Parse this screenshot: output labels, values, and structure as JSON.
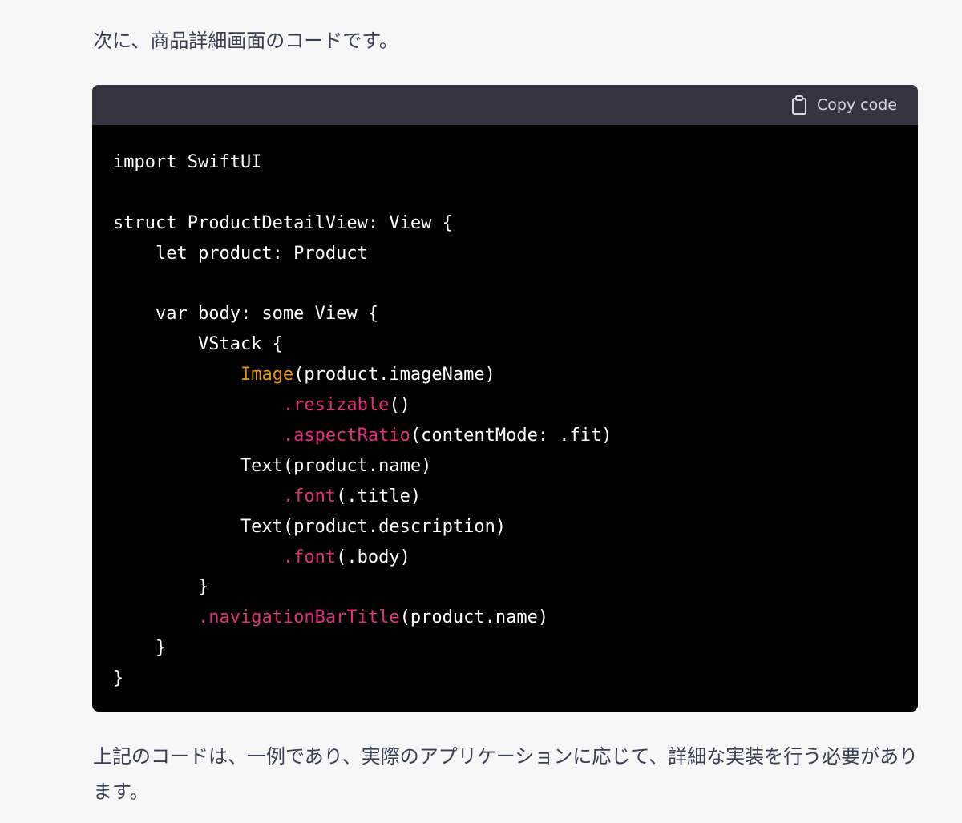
{
  "message": {
    "intro": "次に、商品詳細画面のコードです。",
    "outro": "上記のコードは、一例であり、実際のアプリケーションに応じて、詳細な実装を行う必要があります。"
  },
  "code_block": {
    "copy_label": "Copy code",
    "copy_icon": "clipboard-icon",
    "colors": {
      "header_bg": "#343541",
      "body_bg": "#000000",
      "text": "#ffffff",
      "type_token": "#e9950c",
      "method_token": "#df3079"
    },
    "lines": [
      [
        {
          "t": "import SwiftUI",
          "k": "plain"
        }
      ],
      [],
      [
        {
          "t": "struct ProductDetailView: View {",
          "k": "plain"
        }
      ],
      [
        {
          "t": "    let product: Product",
          "k": "plain"
        }
      ],
      [],
      [
        {
          "t": "    var body: some View {",
          "k": "plain"
        }
      ],
      [
        {
          "t": "        VStack {",
          "k": "plain"
        }
      ],
      [
        {
          "t": "            ",
          "k": "plain"
        },
        {
          "t": "Image",
          "k": "type"
        },
        {
          "t": "(product.imageName)",
          "k": "plain"
        }
      ],
      [
        {
          "t": "                ",
          "k": "plain"
        },
        {
          "t": ".resizable",
          "k": "method"
        },
        {
          "t": "()",
          "k": "plain"
        }
      ],
      [
        {
          "t": "                ",
          "k": "plain"
        },
        {
          "t": ".aspectRatio",
          "k": "method"
        },
        {
          "t": "(contentMode: .fit)",
          "k": "plain"
        }
      ],
      [
        {
          "t": "            Text(product.name)",
          "k": "plain"
        }
      ],
      [
        {
          "t": "                ",
          "k": "plain"
        },
        {
          "t": ".font",
          "k": "method"
        },
        {
          "t": "(.title)",
          "k": "plain"
        }
      ],
      [
        {
          "t": "            Text(product.description)",
          "k": "plain"
        }
      ],
      [
        {
          "t": "                ",
          "k": "plain"
        },
        {
          "t": ".font",
          "k": "method"
        },
        {
          "t": "(.body)",
          "k": "plain"
        }
      ],
      [
        {
          "t": "        }",
          "k": "plain"
        }
      ],
      [
        {
          "t": "        ",
          "k": "plain"
        },
        {
          "t": ".navigationBarTitle",
          "k": "method"
        },
        {
          "t": "(product.name)",
          "k": "plain"
        }
      ],
      [
        {
          "t": "    }",
          "k": "plain"
        }
      ],
      [
        {
          "t": "}",
          "k": "plain"
        }
      ]
    ]
  }
}
